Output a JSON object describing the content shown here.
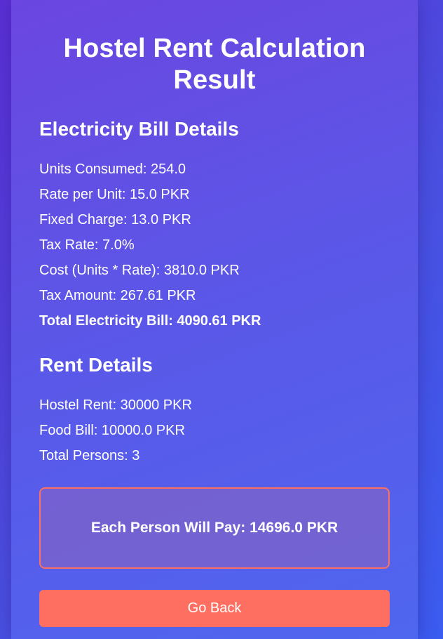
{
  "page": {
    "title": "Hostel Rent Calculation Result"
  },
  "electricity": {
    "heading": "Electricity Bill Details",
    "items": [
      "Units Consumed: 254.0",
      "Rate per Unit: 15.0 PKR",
      "Fixed Charge: 13.0 PKR",
      "Tax Rate: 7.0%",
      "Cost (Units * Rate): 3810.0 PKR",
      "Tax Amount: 267.61 PKR"
    ],
    "total": "Total Electricity Bill: 4090.61 PKR"
  },
  "rent": {
    "heading": "Rent Details",
    "items": [
      "Hostel Rent: 30000 PKR",
      "Food Bill: 10000.0 PKR",
      "Total Persons: 3"
    ]
  },
  "result": {
    "text": "Each Person Will Pay: 14696.0 PKR"
  },
  "actions": {
    "back_label": "Go Back"
  },
  "colors": {
    "accent": "#ff6f61",
    "background_start": "#5b2fd6",
    "background_end": "#3b5cf0"
  }
}
